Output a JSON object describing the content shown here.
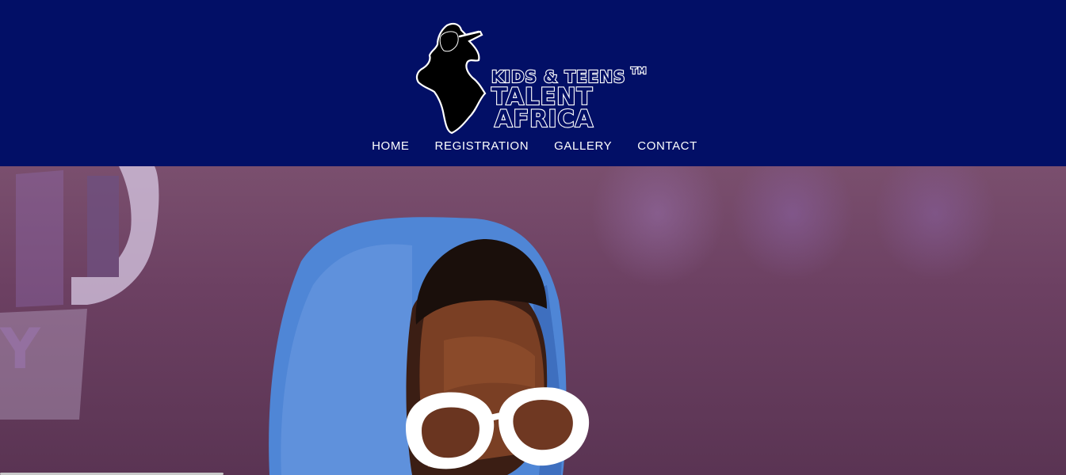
{
  "brand": {
    "line1": "KIDS & TEENS",
    "line2": "TALENT",
    "line3": "AFRICA",
    "trademark": "TM"
  },
  "nav": {
    "items": [
      {
        "label": "HOME"
      },
      {
        "label": "REGISTRATION"
      },
      {
        "label": "GALLERY"
      },
      {
        "label": "CONTACT"
      }
    ]
  },
  "colors": {
    "header_bg": "#020f66",
    "nav_text": "#ffffff",
    "hoodie": "#4f86d6",
    "glasses": "#ffffff"
  },
  "hero": {
    "image": "photo-of-child-in-blue-hoodie-and-white-glasses"
  }
}
